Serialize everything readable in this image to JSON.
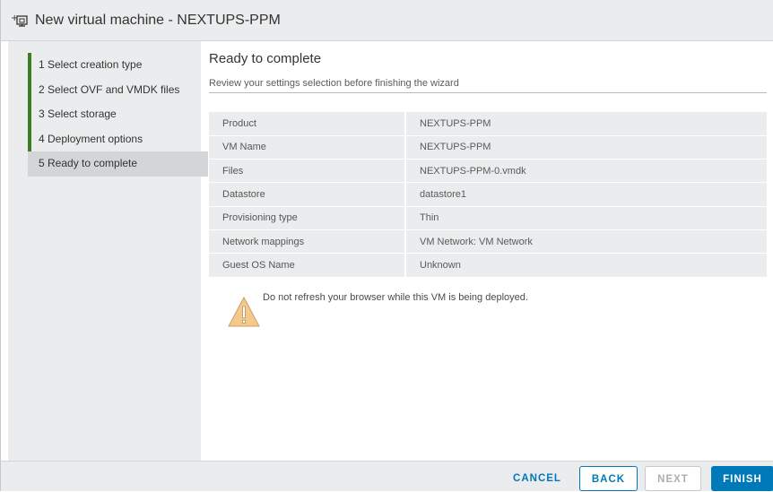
{
  "window": {
    "title": "New virtual machine - NEXTUPS-PPM",
    "icon": "new-vm-icon"
  },
  "steps": [
    {
      "label": "1  Select creation type",
      "state": "done"
    },
    {
      "label": "2  Select OVF and VMDK files",
      "state": "done"
    },
    {
      "label": "3  Select storage",
      "state": "done"
    },
    {
      "label": "4  Deployment options",
      "state": "done"
    },
    {
      "label": "5  Ready to complete",
      "state": "active"
    }
  ],
  "main": {
    "heading": "Ready to complete",
    "subheading": "Review your settings selection before finishing the wizard",
    "summary": [
      {
        "key": "Product",
        "value": "NEXTUPS-PPM"
      },
      {
        "key": "VM Name",
        "value": "NEXTUPS-PPM"
      },
      {
        "key": "Files",
        "value": "NEXTUPS-PPM-0.vmdk"
      },
      {
        "key": "Datastore",
        "value": "datastore1"
      },
      {
        "key": "Provisioning type",
        "value": "Thin"
      },
      {
        "key": "Network mappings",
        "value": "VM Network: VM Network"
      },
      {
        "key": "Guest OS Name",
        "value": "Unknown"
      }
    ],
    "warning": {
      "icon": "warning-icon",
      "text": "Do not refresh your browser while this VM is being deployed."
    }
  },
  "footer": {
    "cancel_label": "CANCEL",
    "back_label": "BACK",
    "next_label": "NEXT",
    "finish_label": "FINISH"
  },
  "colors": {
    "accent": "#0079b8",
    "step_done": "#3a7f20",
    "warning_fill": "#f5c98b"
  }
}
